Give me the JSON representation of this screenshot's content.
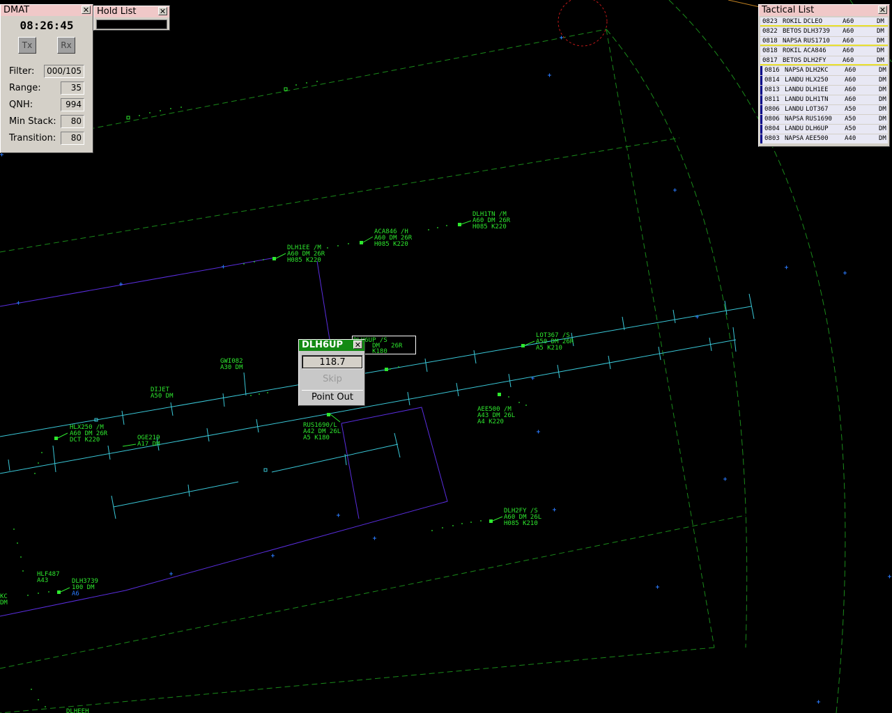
{
  "dmat": {
    "title": "DMAT",
    "close": "✕",
    "clock": "08:26:45",
    "tx": "Tx",
    "rx": "Rx",
    "filter_label": "Filter:",
    "filter": "000/105",
    "range_label": "Range:",
    "range": "35",
    "qnh_label": "QNH:",
    "qnh": "994",
    "minstack_label": "Min Stack:",
    "minstack": "80",
    "transition_label": "Transition:",
    "transition": "80"
  },
  "hold_list": {
    "title": "Hold List",
    "close": "✕"
  },
  "tactical_list": {
    "title": "Tactical List",
    "close": "✕",
    "rows": [
      {
        "time": "0823",
        "fix": "ROKIL",
        "callsign": "DCLEO",
        "alt": "A60",
        "ap": "DM",
        "hl": true
      },
      {
        "time": "0822",
        "fix": "BETOS",
        "callsign": "DLH3739",
        "alt": "A60",
        "ap": "DM",
        "hl": false
      },
      {
        "time": "0818",
        "fix": "NAPSA",
        "callsign": "RUS1710",
        "alt": "A60",
        "ap": "DM",
        "hl": true
      },
      {
        "time": "0818",
        "fix": "ROKIL",
        "callsign": "ACA846",
        "alt": "A60",
        "ap": "DM",
        "hl": false
      },
      {
        "time": "0817",
        "fix": "BETOS",
        "callsign": "DLH2FY",
        "alt": "A60",
        "ap": "DM",
        "hl": true
      },
      {
        "time": "0816",
        "fix": "NAPSA",
        "callsign": "DLH2KC",
        "alt": "A60",
        "ap": "DM",
        "hl": false
      },
      {
        "time": "0814",
        "fix": "LANDU",
        "callsign": "HLX250",
        "alt": "A60",
        "ap": "DM",
        "hl": false
      },
      {
        "time": "0813",
        "fix": "LANDU",
        "callsign": "DLH1EE",
        "alt": "A60",
        "ap": "DM",
        "hl": false
      },
      {
        "time": "0811",
        "fix": "LANDU",
        "callsign": "DLH1TN",
        "alt": "A60",
        "ap": "DM",
        "hl": false
      },
      {
        "time": "0806",
        "fix": "LANDU",
        "callsign": "LOT367",
        "alt": "A50",
        "ap": "DM",
        "hl": false
      },
      {
        "time": "0806",
        "fix": "NAPSA",
        "callsign": "RUS1690",
        "alt": "A50",
        "ap": "DM",
        "hl": false
      },
      {
        "time": "0804",
        "fix": "LANDU",
        "callsign": "DLH6UP",
        "alt": "A50",
        "ap": "DM",
        "hl": false
      },
      {
        "time": "0803",
        "fix": "NAPSA",
        "callsign": "AEE500",
        "alt": "A40",
        "ap": "DM",
        "hl": false
      }
    ]
  },
  "popup": {
    "callsign": "DLH6UP",
    "close": "✕",
    "frequency": "118.7",
    "skip": "Skip",
    "point_out": "Point Out"
  },
  "popup_tag": {
    "line1": "DLH6UP /S",
    "line2": "     DM   26R",
    "line3": "NAV  K180"
  },
  "colors": {
    "background": "#000000",
    "track": "#2ee82e",
    "approach_line": "#3ac8d8",
    "sector_line": "#5a2ee0",
    "range_ring": "#1a8a1a",
    "popup_title": "#138a13",
    "window_title": "#f0c8c8"
  },
  "radar": {
    "tracks": [
      {
        "id": "DLH1TN",
        "lines": [
          "DLH1TN /M",
          "A60   DM   26R",
          "   H085 K220"
        ]
      },
      {
        "id": "ACA846",
        "lines": [
          "ACA846 /H",
          "A60   DM   26R",
          "   H085 K220"
        ]
      },
      {
        "id": "DLH1EE",
        "lines": [
          "DLH1EE /M",
          "A60   DM   26R",
          "   H085 K220"
        ]
      },
      {
        "id": "LOT367",
        "lines": [
          "LOT367 /S",
          "A50   DM   26R",
          "A5     K210"
        ]
      },
      {
        "id": "GWI082",
        "lines": [
          "GWI082",
          "A30   DM"
        ]
      },
      {
        "id": "DIJET",
        "lines": [
          "DIJET",
          "A50   DM"
        ]
      },
      {
        "id": "HLX250",
        "lines": [
          "HLX250 /M",
          "A60   DM   26R",
          "   DCT  K220"
        ]
      },
      {
        "id": "OGE219",
        "lines": [
          "OGE219",
          "A17   DM"
        ]
      },
      {
        "id": "RUS1690",
        "lines": [
          "RUS1690/L",
          "A42   DM   26L",
          "A5     K180"
        ]
      },
      {
        "id": "AEE500",
        "lines": [
          "AEE500 /M",
          "A43   DM   26L",
          "A4     K220"
        ]
      },
      {
        "id": "DLH2FY",
        "lines": [
          "DLH2FY /S",
          "A60   DM   26L",
          "   H085 K210"
        ]
      },
      {
        "id": "HLF487",
        "lines": [
          "HLF487",
          "A43"
        ]
      },
      {
        "id": "DLH3739",
        "lines": [
          "DLH3739",
          "100   DM",
          "A6"
        ]
      },
      {
        "id": "KC",
        "lines": [
          "KC",
          "  DM"
        ]
      },
      {
        "id": "DLHEEH",
        "lines": [
          "DLHEEH"
        ]
      }
    ]
  }
}
